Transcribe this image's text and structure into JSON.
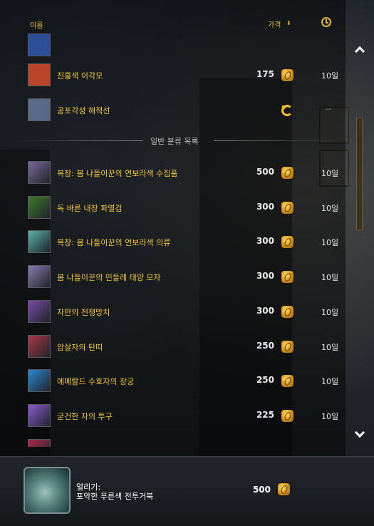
{
  "header": {
    "name_label": "이름",
    "price_label": "가격",
    "price_sort_icon": "sort-down-icon",
    "time_icon": "clock-icon"
  },
  "rows_top": [
    {
      "name": "",
      "price": "",
      "time": "",
      "icon": "item-icon-partial",
      "icon_color": "#2d4f9a"
    },
    {
      "name": "진홍색 이각모",
      "price": "175",
      "time": "10일",
      "icon": "hat-icon",
      "icon_color": "#b8452a"
    },
    {
      "name": "공포각성 해적선",
      "price": "",
      "time": "--",
      "icon": "ship-toy-icon",
      "icon_color": "#5a6b8a",
      "refresh": true
    }
  ],
  "section_divider": "일반 분류 목록",
  "rows": [
    {
      "name": "복장: 봄 나들이꾼의 연보라색 수집품",
      "price": "500",
      "time": "10일",
      "icon": "transmog-set-icon",
      "icon_color": "#7a6a9a"
    },
    {
      "name": "독 바른 내장 파열검",
      "price": "300",
      "time": "10일",
      "icon": "sword-icon",
      "icon_color": "#3e7a2a"
    },
    {
      "name": "복장: 봄 나들이꾼의 연보라색 의류",
      "price": "300",
      "time": "10일",
      "icon": "robe-icon",
      "icon_color": "#5ab0a8"
    },
    {
      "name": "봄 나들이꾼의 민들레 태양 모자",
      "price": "300",
      "time": "10일",
      "icon": "sun-hat-icon",
      "icon_color": "#8a7ab0"
    },
    {
      "name": "자만의 전쟁망치",
      "price": "300",
      "time": "10일",
      "icon": "warhammer-icon",
      "icon_color": "#7a4aa8"
    },
    {
      "name": "암살자의 탄띠",
      "price": "250",
      "time": "10일",
      "icon": "bandolier-icon",
      "icon_color": "#a83848"
    },
    {
      "name": "에메랄드 수호자의 장궁",
      "price": "250",
      "time": "10일",
      "icon": "longbow-icon",
      "icon_color": "#2a8ad0"
    },
    {
      "name": "굳건한 자의 투구",
      "price": "225",
      "time": "10일",
      "icon": "helmet-icon",
      "icon_color": "#8a5ad0"
    },
    {
      "name": "",
      "price": "",
      "time": "",
      "icon": "item-icon-partial",
      "icon_color": "#a8284a"
    }
  ],
  "footer": {
    "label": "얼리기:",
    "title": "포악한 푸른색 전투거북",
    "price": "500",
    "icon": "turtle-mount-icon"
  },
  "colors": {
    "accent": "#f0c838",
    "price_text": "#e9e9e9"
  }
}
